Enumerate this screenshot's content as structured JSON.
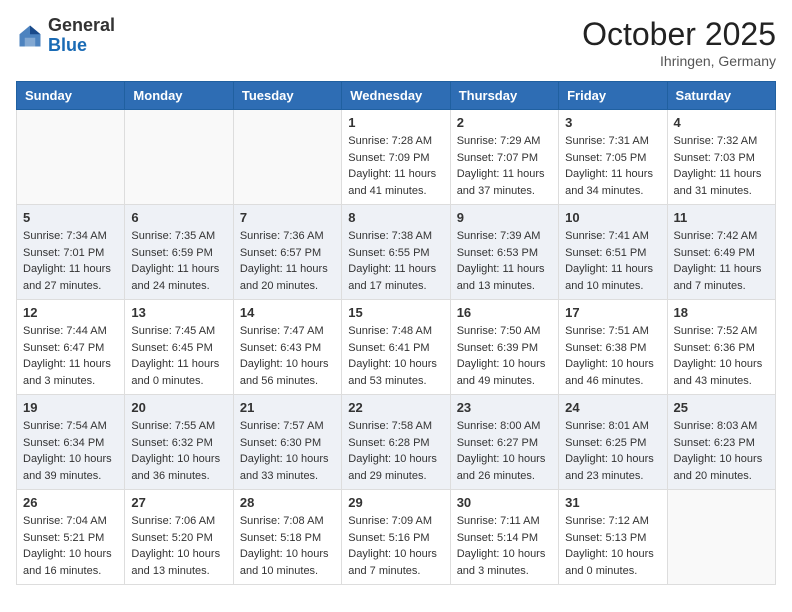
{
  "header": {
    "logo_general": "General",
    "logo_blue": "Blue",
    "month": "October 2025",
    "location": "Ihringen, Germany"
  },
  "days_of_week": [
    "Sunday",
    "Monday",
    "Tuesday",
    "Wednesday",
    "Thursday",
    "Friday",
    "Saturday"
  ],
  "weeks": [
    [
      {
        "day": "",
        "info": ""
      },
      {
        "day": "",
        "info": ""
      },
      {
        "day": "",
        "info": ""
      },
      {
        "day": "1",
        "info": "Sunrise: 7:28 AM\nSunset: 7:09 PM\nDaylight: 11 hours and 41 minutes."
      },
      {
        "day": "2",
        "info": "Sunrise: 7:29 AM\nSunset: 7:07 PM\nDaylight: 11 hours and 37 minutes."
      },
      {
        "day": "3",
        "info": "Sunrise: 7:31 AM\nSunset: 7:05 PM\nDaylight: 11 hours and 34 minutes."
      },
      {
        "day": "4",
        "info": "Sunrise: 7:32 AM\nSunset: 7:03 PM\nDaylight: 11 hours and 31 minutes."
      }
    ],
    [
      {
        "day": "5",
        "info": "Sunrise: 7:34 AM\nSunset: 7:01 PM\nDaylight: 11 hours and 27 minutes."
      },
      {
        "day": "6",
        "info": "Sunrise: 7:35 AM\nSunset: 6:59 PM\nDaylight: 11 hours and 24 minutes."
      },
      {
        "day": "7",
        "info": "Sunrise: 7:36 AM\nSunset: 6:57 PM\nDaylight: 11 hours and 20 minutes."
      },
      {
        "day": "8",
        "info": "Sunrise: 7:38 AM\nSunset: 6:55 PM\nDaylight: 11 hours and 17 minutes."
      },
      {
        "day": "9",
        "info": "Sunrise: 7:39 AM\nSunset: 6:53 PM\nDaylight: 11 hours and 13 minutes."
      },
      {
        "day": "10",
        "info": "Sunrise: 7:41 AM\nSunset: 6:51 PM\nDaylight: 11 hours and 10 minutes."
      },
      {
        "day": "11",
        "info": "Sunrise: 7:42 AM\nSunset: 6:49 PM\nDaylight: 11 hours and 7 minutes."
      }
    ],
    [
      {
        "day": "12",
        "info": "Sunrise: 7:44 AM\nSunset: 6:47 PM\nDaylight: 11 hours and 3 minutes."
      },
      {
        "day": "13",
        "info": "Sunrise: 7:45 AM\nSunset: 6:45 PM\nDaylight: 11 hours and 0 minutes."
      },
      {
        "day": "14",
        "info": "Sunrise: 7:47 AM\nSunset: 6:43 PM\nDaylight: 10 hours and 56 minutes."
      },
      {
        "day": "15",
        "info": "Sunrise: 7:48 AM\nSunset: 6:41 PM\nDaylight: 10 hours and 53 minutes."
      },
      {
        "day": "16",
        "info": "Sunrise: 7:50 AM\nSunset: 6:39 PM\nDaylight: 10 hours and 49 minutes."
      },
      {
        "day": "17",
        "info": "Sunrise: 7:51 AM\nSunset: 6:38 PM\nDaylight: 10 hours and 46 minutes."
      },
      {
        "day": "18",
        "info": "Sunrise: 7:52 AM\nSunset: 6:36 PM\nDaylight: 10 hours and 43 minutes."
      }
    ],
    [
      {
        "day": "19",
        "info": "Sunrise: 7:54 AM\nSunset: 6:34 PM\nDaylight: 10 hours and 39 minutes."
      },
      {
        "day": "20",
        "info": "Sunrise: 7:55 AM\nSunset: 6:32 PM\nDaylight: 10 hours and 36 minutes."
      },
      {
        "day": "21",
        "info": "Sunrise: 7:57 AM\nSunset: 6:30 PM\nDaylight: 10 hours and 33 minutes."
      },
      {
        "day": "22",
        "info": "Sunrise: 7:58 AM\nSunset: 6:28 PM\nDaylight: 10 hours and 29 minutes."
      },
      {
        "day": "23",
        "info": "Sunrise: 8:00 AM\nSunset: 6:27 PM\nDaylight: 10 hours and 26 minutes."
      },
      {
        "day": "24",
        "info": "Sunrise: 8:01 AM\nSunset: 6:25 PM\nDaylight: 10 hours and 23 minutes."
      },
      {
        "day": "25",
        "info": "Sunrise: 8:03 AM\nSunset: 6:23 PM\nDaylight: 10 hours and 20 minutes."
      }
    ],
    [
      {
        "day": "26",
        "info": "Sunrise: 7:04 AM\nSunset: 5:21 PM\nDaylight: 10 hours and 16 minutes."
      },
      {
        "day": "27",
        "info": "Sunrise: 7:06 AM\nSunset: 5:20 PM\nDaylight: 10 hours and 13 minutes."
      },
      {
        "day": "28",
        "info": "Sunrise: 7:08 AM\nSunset: 5:18 PM\nDaylight: 10 hours and 10 minutes."
      },
      {
        "day": "29",
        "info": "Sunrise: 7:09 AM\nSunset: 5:16 PM\nDaylight: 10 hours and 7 minutes."
      },
      {
        "day": "30",
        "info": "Sunrise: 7:11 AM\nSunset: 5:14 PM\nDaylight: 10 hours and 3 minutes."
      },
      {
        "day": "31",
        "info": "Sunrise: 7:12 AM\nSunset: 5:13 PM\nDaylight: 10 hours and 0 minutes."
      },
      {
        "day": "",
        "info": ""
      }
    ]
  ]
}
